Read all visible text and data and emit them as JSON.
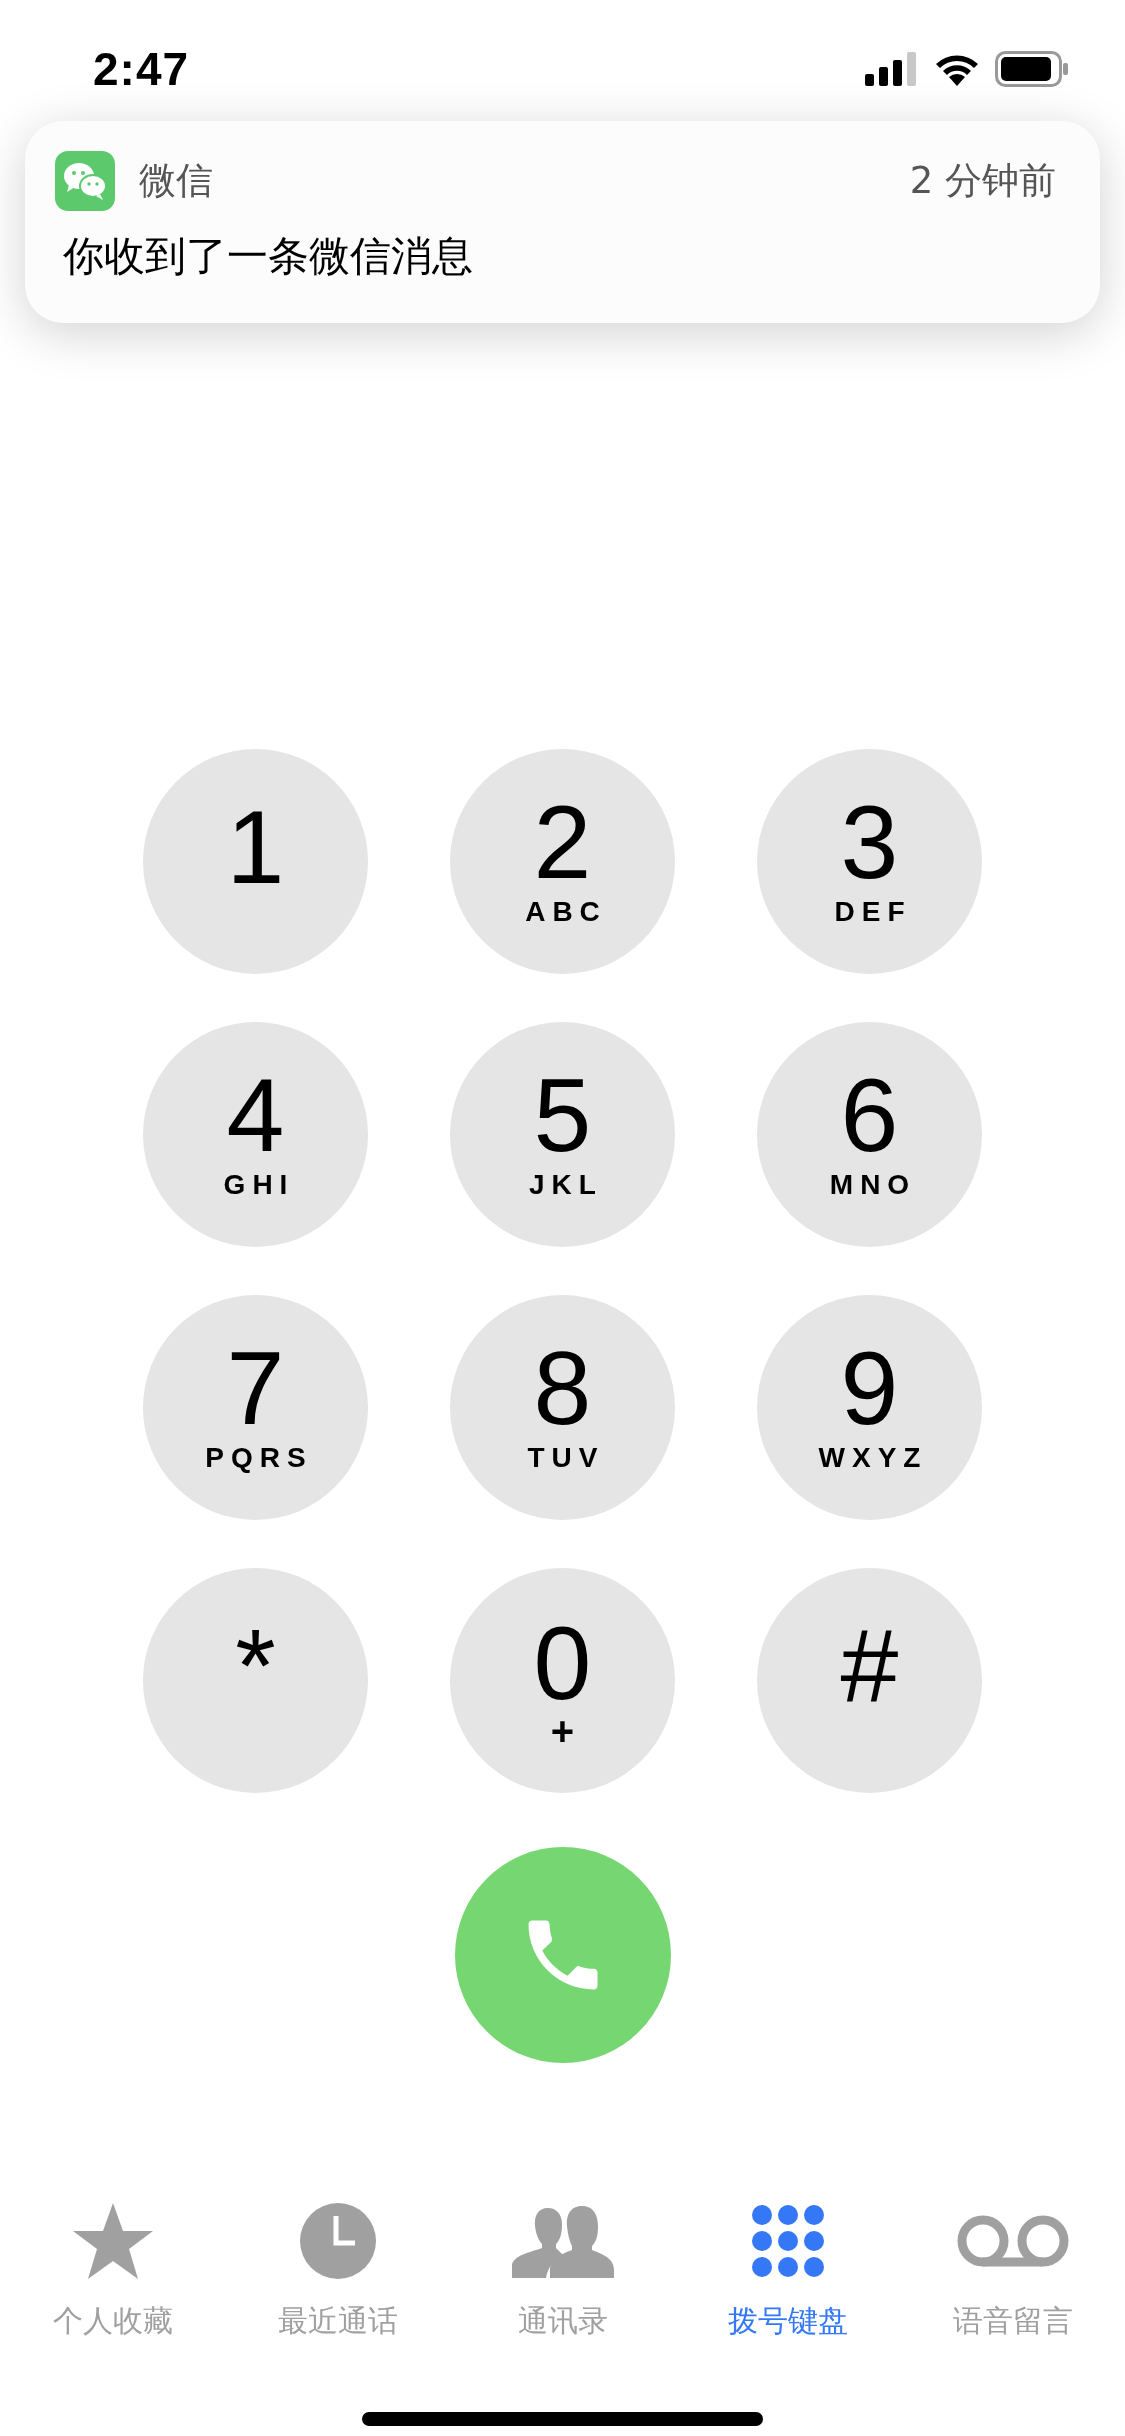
{
  "status_bar": {
    "time": "2:47"
  },
  "notification": {
    "app": "微信",
    "time": "2 分钟前",
    "message": "你收到了一条微信消息"
  },
  "keypad": [
    {
      "digit": "1"
    },
    {
      "digit": "2",
      "letters": "ABC"
    },
    {
      "digit": "3",
      "letters": "DEF"
    },
    {
      "digit": "4",
      "letters": "GHI"
    },
    {
      "digit": "5",
      "letters": "JKL"
    },
    {
      "digit": "6",
      "letters": "MNO"
    },
    {
      "digit": "7",
      "letters": "PQRS"
    },
    {
      "digit": "8",
      "letters": "TUV"
    },
    {
      "digit": "9",
      "letters": "WXYZ"
    },
    {
      "digit": "*"
    },
    {
      "digit": "0",
      "letters": "+"
    },
    {
      "digit": "#"
    }
  ],
  "tabs": [
    {
      "kind": "favorites",
      "label": "个人收藏",
      "selected": false
    },
    {
      "kind": "recents",
      "label": "最近通话",
      "selected": false
    },
    {
      "kind": "contacts",
      "label": "通讯录",
      "selected": false
    },
    {
      "kind": "keypad",
      "label": "拨号键盘",
      "selected": true
    },
    {
      "kind": "voicemail",
      "label": "语音留言",
      "selected": false
    }
  ]
}
